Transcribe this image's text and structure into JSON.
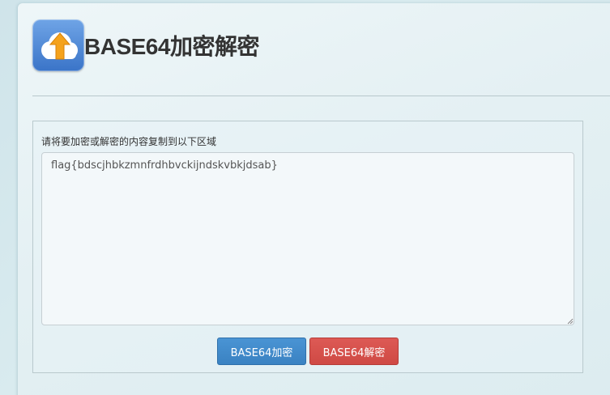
{
  "header": {
    "title": "BASE64加密解密",
    "logo_icon": "cloud-upload-icon"
  },
  "form": {
    "prompt": "请将要加密或解密的内容复制到以下区域",
    "input_value": "flag{bdscjhbkzmnfrdhbvckijndskvbkjdsab}"
  },
  "buttons": {
    "encode_label": "BASE64加密",
    "decode_label": "BASE64解密"
  },
  "colors": {
    "encode": "#3f88c8",
    "decode": "#d5504b"
  }
}
